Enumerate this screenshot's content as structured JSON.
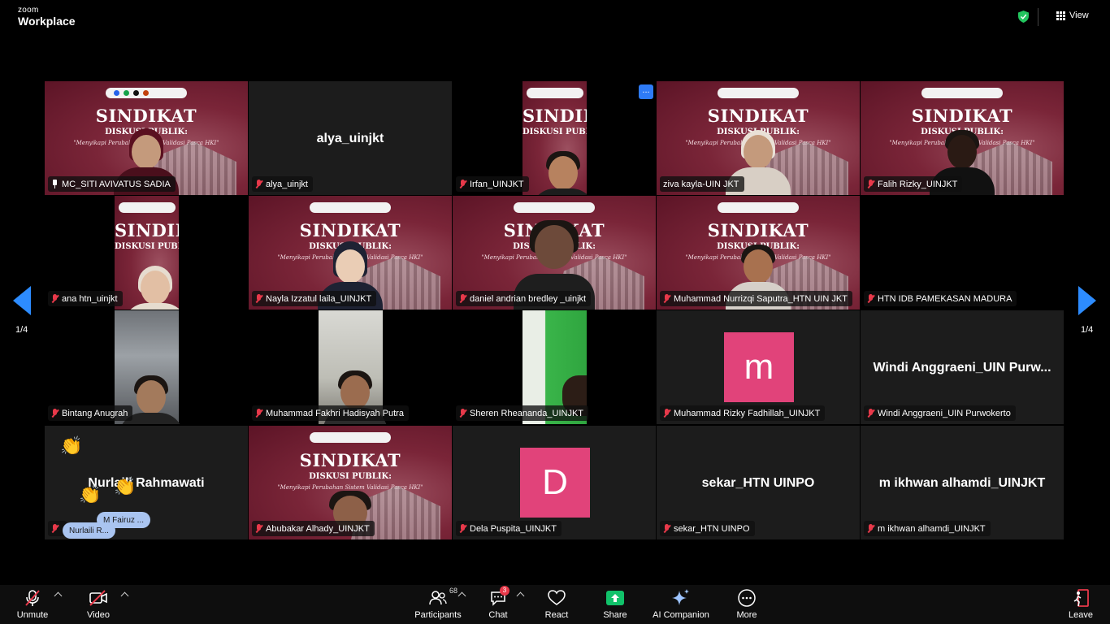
{
  "app": {
    "brand_small": "zoom",
    "brand_big": "Workplace"
  },
  "topbar": {
    "view_label": "View",
    "shield_icon": "shield-check-icon"
  },
  "colors": {
    "accent": "#2d8cff",
    "active_speaker": "#54c94c",
    "muted": "#e8394a",
    "avatar": "#e1437a",
    "share": "#11c26a"
  },
  "slide": {
    "title": "SINDIKAT",
    "subtitle": "DISKUSI PUBLIK:",
    "tagline": "\"Menyikapi Perubahan Sistem Validasi Pasca HKI\""
  },
  "pagination": {
    "left": "1/4",
    "right": "1/4"
  },
  "participants": [
    {
      "name": "MC_SITI AVIVATUS SADIA",
      "pinned": true,
      "active": true
    },
    {
      "name": "alya_uinjkt",
      "display": "alya_uinjkt"
    },
    {
      "name": "Irfan_UINJKT"
    },
    {
      "name": "ziva kayla-UIN JKT"
    },
    {
      "name": "Falih Rizky_UINJKT"
    },
    {
      "name": "ana htn_uinjkt"
    },
    {
      "name": "Nayla Izzatul laila_UINJKT"
    },
    {
      "name": "daniel andrian bredley _uinjkt"
    },
    {
      "name": "Muhammad Nurrizqi Saputra_HTN UIN JKT"
    },
    {
      "name": "HTN IDB PAMEKASAN MADURA"
    },
    {
      "name": "Bintang Anugrah"
    },
    {
      "name": "Muhammad Fakhri Hadisyah Putra"
    },
    {
      "name": "Sheren Rheananda_UINJKT"
    },
    {
      "name": "Muhammad Rizky Fadhillah_UINJKT",
      "avatar": "m"
    },
    {
      "name": "Windi Anggraeni_UIN Purwokerto",
      "display": "Windi Anggraeni_UIN Purw..."
    },
    {
      "name": "",
      "display": "Nurlaili Rahmawati"
    },
    {
      "name": "Abubakar Alhady_UINJKT"
    },
    {
      "name": "Dela Puspita_UINJKT",
      "avatar": "D"
    },
    {
      "name": "sekar_HTN UINPO",
      "display": "sekar_HTN UINPO"
    },
    {
      "name": "m ikhwan alhamdi_UINJKT",
      "display": "m ikhwan alhamdi_UINJKT"
    }
  ],
  "reactions": {
    "emoji": "👏",
    "tag_1": "M Fairuz ...",
    "tag_2": "Nurlaili R..."
  },
  "more_button": "...",
  "toolbar": {
    "unmute": "Unmute",
    "video": "Video",
    "participants": "Participants",
    "participants_count": "68",
    "chat": "Chat",
    "chat_badge": "3",
    "react": "React",
    "share": "Share",
    "ai_companion": "AI Companion",
    "more": "More",
    "leave": "Leave"
  }
}
